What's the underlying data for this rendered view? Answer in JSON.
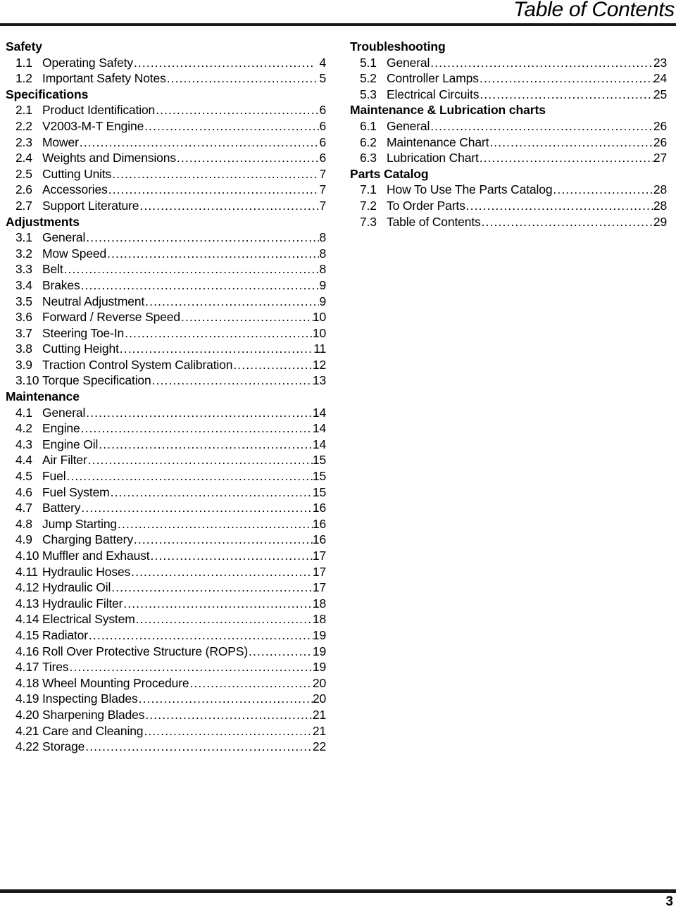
{
  "header": {
    "title": "Table of Contents"
  },
  "footer": {
    "page_number": "3"
  },
  "columns": {
    "left": [
      {
        "heading": "Safety",
        "entries": [
          {
            "num": "1.1",
            "title": "Operating Safety",
            "page": "4",
            "gap": true
          },
          {
            "num": "1.2",
            "title": "Important Safety Notes",
            "page": "5",
            "gap": false
          }
        ]
      },
      {
        "heading": "Specifications",
        "entries": [
          {
            "num": "2.1",
            "title": "Product Identification",
            "page": "6",
            "gap": false
          },
          {
            "num": "2.2",
            "title": "V2003-M-T Engine",
            "page": "6",
            "gap": false
          },
          {
            "num": "2.3",
            "title": "Mower",
            "page": "6",
            "gap": false
          },
          {
            "num": "2.4",
            "title": "Weights and Dimensions",
            "page": "6",
            "gap": false
          },
          {
            "num": "2.5",
            "title": "Cutting Units",
            "page": "7",
            "gap": false
          },
          {
            "num": "2.6",
            "title": "Accessories",
            "page": "7",
            "gap": false
          },
          {
            "num": "2.7",
            "title": "Support Literature",
            "page": "7",
            "gap": false
          }
        ]
      },
      {
        "heading": "Adjustments",
        "entries": [
          {
            "num": "3.1",
            "title": "General",
            "page": "8",
            "gap": false
          },
          {
            "num": "3.2",
            "title": "Mow Speed",
            "page": "8",
            "gap": false
          },
          {
            "num": "3.3",
            "title": "Belt",
            "page": "8",
            "gap": false
          },
          {
            "num": "3.4",
            "title": "Brakes",
            "page": "9",
            "gap": false
          },
          {
            "num": "3.5",
            "title": "Neutral Adjustment",
            "page": "9",
            "gap": false
          },
          {
            "num": "3.6",
            "title": "Forward / Reverse Speed",
            "page": "10",
            "gap": false
          },
          {
            "num": "3.7",
            "title": "Steering Toe-In",
            "page": "10",
            "gap": false
          },
          {
            "num": "3.8",
            "title": "Cutting Height",
            "page": "11",
            "gap": false
          },
          {
            "num": "3.9",
            "title": "Traction Control System Calibration",
            "page": "12",
            "gap": false
          },
          {
            "num": "3.10",
            "title": "Torque Specification",
            "page": "13",
            "gap": false
          }
        ]
      },
      {
        "heading": "Maintenance",
        "entries": [
          {
            "num": "4.1",
            "title": "General",
            "page": "14",
            "gap": false
          },
          {
            "num": "4.2",
            "title": "Engine",
            "page": "14",
            "gap": false
          },
          {
            "num": "4.3",
            "title": "Engine Oil",
            "page": "14",
            "gap": false
          },
          {
            "num": "4.4",
            "title": "Air Filter",
            "page": "15",
            "gap": false
          },
          {
            "num": "4.5",
            "title": "Fuel",
            "page": "15",
            "gap": false
          },
          {
            "num": "4.6",
            "title": "Fuel System",
            "page": "15",
            "gap": false
          },
          {
            "num": "4.7",
            "title": "Battery",
            "page": "16",
            "gap": false
          },
          {
            "num": "4.8",
            "title": "Jump Starting",
            "page": "16",
            "gap": false
          },
          {
            "num": "4.9",
            "title": "Charging Battery",
            "page": "16",
            "gap": false
          },
          {
            "num": "4.10",
            "title": "Muffler and Exhaust",
            "page": "17",
            "gap": false
          },
          {
            "num": "4.11",
            "title": "Hydraulic Hoses",
            "page": "17",
            "gap": false
          },
          {
            "num": "4.12",
            "title": "Hydraulic Oil",
            "page": "17",
            "gap": false
          },
          {
            "num": "4.13",
            "title": "Hydraulic Filter",
            "page": "18",
            "gap": false
          },
          {
            "num": "4.14",
            "title": "Electrical System",
            "page": "18",
            "gap": false
          },
          {
            "num": "4.15",
            "title": "Radiator",
            "page": "19",
            "gap": false
          },
          {
            "num": "4.16",
            "title": "Roll Over Protective Structure (ROPS)",
            "page": "19",
            "gap": false
          },
          {
            "num": "4.17",
            "title": "Tires",
            "page": "19",
            "gap": false
          },
          {
            "num": "4.18",
            "title": "Wheel Mounting Procedure",
            "page": "20",
            "gap": false
          },
          {
            "num": "4.19",
            "title": "Inspecting Blades",
            "page": "20",
            "gap": false
          },
          {
            "num": "4.20",
            "title": "Sharpening Blades",
            "page": "21",
            "gap": false
          },
          {
            "num": "4.21",
            "title": "Care and Cleaning",
            "page": "21",
            "gap": false
          },
          {
            "num": "4.22",
            "title": "Storage",
            "page": "22",
            "gap": false
          }
        ]
      }
    ],
    "right": [
      {
        "heading": "Troubleshooting",
        "entries": [
          {
            "num": "5.1",
            "title": "General",
            "page": "23",
            "gap": false
          },
          {
            "num": "5.2",
            "title": "Controller Lamps",
            "page": "24",
            "gap": false
          },
          {
            "num": "5.3",
            "title": "Electrical Circuits",
            "page": "25",
            "gap": false
          }
        ]
      },
      {
        "heading": "Maintenance & Lubrication charts",
        "entries": [
          {
            "num": "6.1",
            "title": "General",
            "page": "26",
            "gap": false
          },
          {
            "num": "6.2",
            "title": "Maintenance Chart",
            "page": "26",
            "gap": false
          },
          {
            "num": "6.3",
            "title": "Lubrication Chart",
            "page": "27",
            "gap": false
          }
        ]
      },
      {
        "heading": "Parts Catalog",
        "entries": [
          {
            "num": "7.1",
            "title": "How To Use The Parts Catalog",
            "page": "28",
            "gap": false
          },
          {
            "num": "7.2",
            "title": "To Order Parts",
            "page": "28",
            "gap": false
          },
          {
            "num": "7.3",
            "title": "Table of Contents",
            "page": "29",
            "gap": false
          }
        ]
      }
    ]
  }
}
